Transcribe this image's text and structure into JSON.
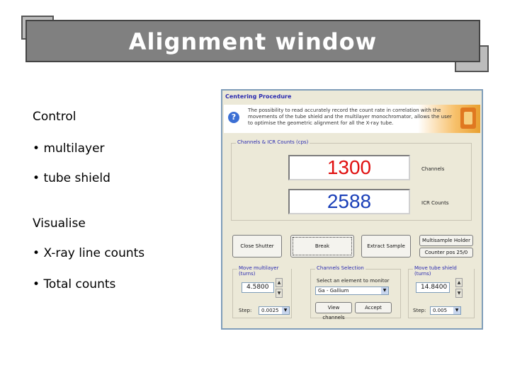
{
  "slide": {
    "title": "Alignment window",
    "sections": [
      {
        "heading": "Control",
        "bullets": [
          "multilayer",
          "tube shield"
        ]
      },
      {
        "heading": "Visualise",
        "bullets": [
          "X-ray line counts",
          "Total counts"
        ]
      }
    ]
  },
  "dialog": {
    "title": "Centering Procedure",
    "info_text": "The possibility to read accurately record the count rate in correlation with the movements of the tube shield and the multilayer monochromator, allows the user to optimise the geometric alignment for all the X-ray tube.",
    "counts_group_label": "Channels & ICR Counts (cps)",
    "channels_value": "1300",
    "channels_label": "Channels",
    "icr_value": "2588",
    "icr_label": "ICR Counts",
    "buttons": {
      "close_shutter": "Close Shutter",
      "break": "Break",
      "extract_sample": "Extract Sample",
      "multisample_holder": "Multisample Holder",
      "counter": "Counter pos 25/0",
      "view_channels": "View channels",
      "accept": "Accept"
    },
    "multilayer": {
      "label": "Move multilayer (turns)",
      "value": "4.5800",
      "step_label": "Step:",
      "step_value": "0.0025"
    },
    "monitor": {
      "label": "Channels Selection",
      "select_label": "Select an element to monitor",
      "select_value": "Ga - Gallium"
    },
    "tube": {
      "label": "Move tube shield (turns)",
      "value": "14.8400",
      "step_label": "Step:",
      "step_value": "0.005"
    }
  }
}
